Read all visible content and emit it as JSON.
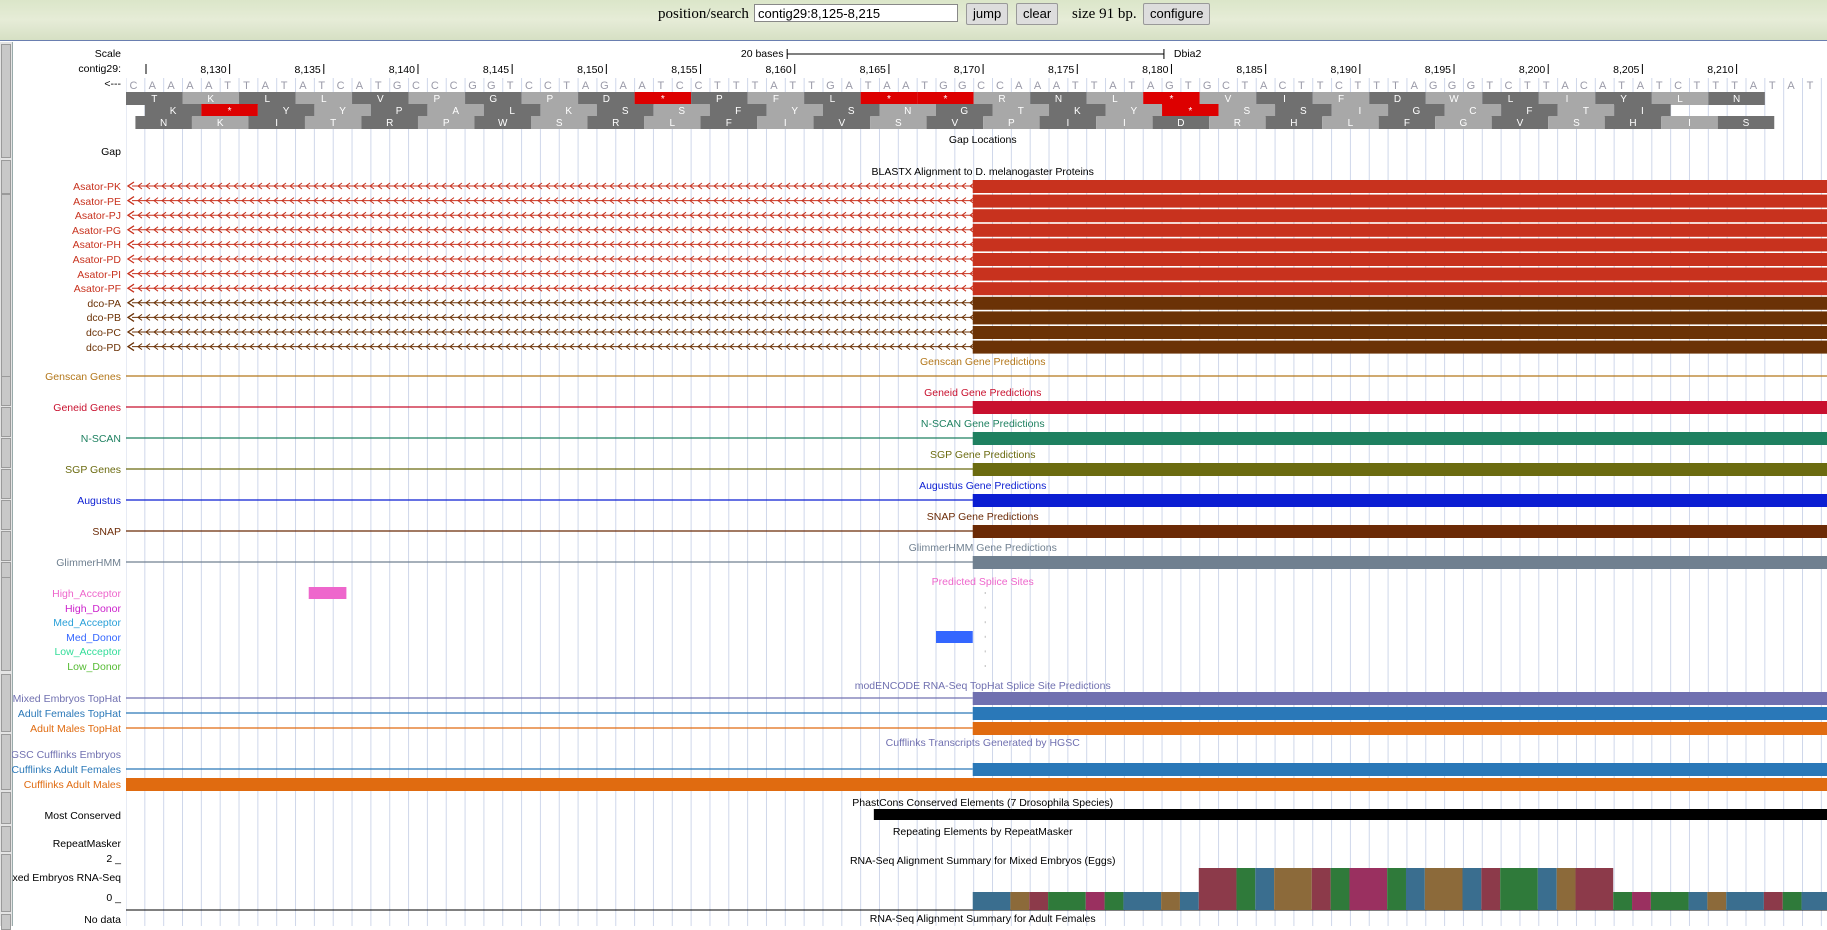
{
  "search": {
    "label": "position/search",
    "value": "contig29:8,125-8,215",
    "jump_label": "jump",
    "clear_label": "clear",
    "size_text": "size 91 bp.",
    "configure_label": "configure"
  },
  "ruler": {
    "scale_label": "Scale",
    "contig_label": "contig29:",
    "arrow_label": "<---",
    "scalebar_text": "20 bases",
    "scalebar_right_label": "Dbia2",
    "ticks": [
      "8,130",
      "8,135",
      "8,140",
      "8,145",
      "8,150",
      "8,155",
      "8,160",
      "8,165",
      "8,170",
      "8,175",
      "8,180",
      "8,185",
      "8,190",
      "8,195",
      "8,200",
      "8,205",
      "8,210"
    ],
    "sequence": "CAAAATTATATCATGCCCGGTCCTAGAATCCTTTATTGATAATGGCCAAATTATAGTGCTACTTCTTTAGGGTCTTACATATCTTTATAT"
  },
  "translation": {
    "frame1": [
      "T",
      "K",
      "L",
      "L",
      "V",
      "P",
      "G",
      "P",
      "D",
      "*",
      "P",
      "F",
      "L",
      "*",
      "*",
      "R",
      "N",
      "L",
      "*",
      "V",
      "I",
      "F",
      "D",
      "W",
      "L",
      "I",
      "Y",
      "L",
      "N"
    ],
    "frame2": [
      "K",
      "*",
      "Y",
      "Y",
      "P",
      "A",
      "L",
      "K",
      "S",
      "S",
      "F",
      "Y",
      "S",
      "N",
      "G",
      "T",
      "K",
      "Y",
      "*",
      "S",
      "S",
      "I",
      "G",
      "C",
      "F",
      "T",
      "I"
    ],
    "frame3": [
      "N",
      "K",
      "I",
      "T",
      "R",
      "P",
      "W",
      "S",
      "R",
      "L",
      "F",
      "I",
      "V",
      "S",
      "V",
      "P",
      "I",
      "I",
      "D",
      "R",
      "H",
      "L",
      "F",
      "G",
      "V",
      "S",
      "H",
      "I",
      "S"
    ],
    "stop_color": "#dd0000"
  },
  "tracks": {
    "gap": {
      "label": "Gap",
      "title": "Gap Locations"
    },
    "blastx": {
      "title": "BLASTX Alignment to D. melanogaster Proteins",
      "asator_color": "#c8321e",
      "dco_color": "#6b3206",
      "items": [
        {
          "label": "Asator-PK",
          "group": "asator"
        },
        {
          "label": "Asator-PE",
          "group": "asator"
        },
        {
          "label": "Asator-PJ",
          "group": "asator"
        },
        {
          "label": "Asator-PG",
          "group": "asator"
        },
        {
          "label": "Asator-PH",
          "group": "asator"
        },
        {
          "label": "Asator-PD",
          "group": "asator"
        },
        {
          "label": "Asator-PI",
          "group": "asator"
        },
        {
          "label": "Asator-PF",
          "group": "asator"
        },
        {
          "label": "dco-PA",
          "group": "dco"
        },
        {
          "label": "dco-PB",
          "group": "dco"
        },
        {
          "label": "dco-PC",
          "group": "dco"
        },
        {
          "label": "dco-PD",
          "group": "dco"
        }
      ]
    },
    "predictions": [
      {
        "label": "Genscan Genes",
        "title": "Genscan Gene Predictions",
        "color": "#b3771a",
        "block": false
      },
      {
        "label": "Geneid Genes",
        "title": "Geneid Gene Predictions",
        "color": "#c8102e",
        "block": true
      },
      {
        "label": "N-SCAN",
        "title": "N-SCAN Gene Predictions",
        "color": "#1e8060",
        "block": true
      },
      {
        "label": "SGP Genes",
        "title": "SGP Gene Predictions",
        "color": "#6b6b10",
        "block": true
      },
      {
        "label": "Augustus",
        "title": "Augustus Gene Predictions",
        "color": "#0b1ed2",
        "block": true
      },
      {
        "label": "SNAP",
        "title": "SNAP Gene Predictions",
        "color": "#6b2a06",
        "block": true
      },
      {
        "label": "GlimmerHMM",
        "title": "GlimmerHMM Gene Predictions",
        "color": "#708090",
        "block": true
      }
    ],
    "splice": {
      "title": "Predicted Splice Sites",
      "items": [
        {
          "label": "High_Acceptor",
          "color": "#ee66cc"
        },
        {
          "label": "High_Donor",
          "color": "#cc22cc"
        },
        {
          "label": "Med_Acceptor",
          "color": "#2aa0d8"
        },
        {
          "label": "Med_Donor",
          "color": "#3366ff"
        },
        {
          "label": "Low_Acceptor",
          "color": "#33dd99"
        },
        {
          "label": "Low_Donor",
          "color": "#55bb33"
        }
      ]
    },
    "tophat": {
      "title": "modENCODE RNA-Seq TopHat Splice Site Predictions",
      "items": [
        {
          "label": "Mixed Embryos TopHat",
          "color": "#7070b0"
        },
        {
          "label": "Adult Females TopHat",
          "color": "#2a78b8"
        },
        {
          "label": "Adult Males TopHat",
          "color": "#e06b10"
        }
      ]
    },
    "cufflinks": {
      "title": "Cufflinks Transcripts Generated by HGSC",
      "items": [
        {
          "label": "HGSC Cufflinks Embryos",
          "color": "#7070b0"
        },
        {
          "label": "Cufflinks Adult Females",
          "color": "#2a78b8"
        },
        {
          "label": "Cufflinks Adult Males",
          "color": "#e06b10"
        }
      ]
    },
    "phastcons": {
      "label": "Most Conserved",
      "title": "PhastCons Conserved Elements (7 Drosophila Species)"
    },
    "repeatmasker": {
      "label": "RepeatMasker",
      "title": "Repeating Elements by RepeatMasker"
    },
    "rnaseq": {
      "label": "Mixed Embryos RNA-Seq",
      "title": "RNA-Seq Alignment Summary for Mixed Embryos (Eggs)",
      "ymax": "2 _",
      "ymin": "0 _"
    },
    "bottom_label": "No data",
    "bottom_title": "RNA-Seq Alignment Summary for Adult Females"
  }
}
